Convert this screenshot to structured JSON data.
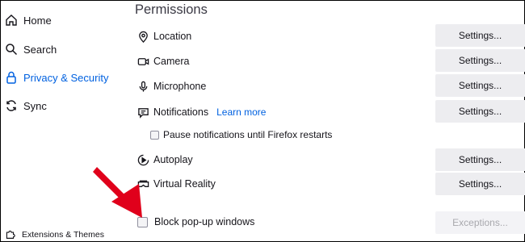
{
  "sidebar": {
    "items": [
      {
        "label": "Home",
        "icon": "home-icon"
      },
      {
        "label": "Search",
        "icon": "search-icon"
      },
      {
        "label": "Privacy & Security",
        "icon": "lock-icon",
        "selected": true
      },
      {
        "label": "Sync",
        "icon": "sync-icon"
      }
    ],
    "extensions_label": "Extensions & Themes"
  },
  "permissions": {
    "title": "Permissions",
    "rows": [
      {
        "label": "Location",
        "icon": "location-pin-icon",
        "button": "Settings..."
      },
      {
        "label": "Camera",
        "icon": "camera-icon",
        "button": "Settings..."
      },
      {
        "label": "Microphone",
        "icon": "microphone-icon",
        "button": "Settings..."
      },
      {
        "label": "Notifications",
        "icon": "notification-bubble-icon",
        "button": "Settings...",
        "link": "Learn more"
      },
      {
        "label": "Autoplay",
        "icon": "autoplay-icon",
        "button": "Settings..."
      },
      {
        "label": "Virtual Reality",
        "icon": "vr-headset-icon",
        "button": "Settings..."
      }
    ],
    "pause_notifications_label": "Pause notifications until Firefox restarts",
    "block_popups_label": "Block pop-up windows",
    "exceptions_label": "Exceptions..."
  },
  "colors": {
    "accent": "#0061e0",
    "annotation_arrow": "#e0001b",
    "button_bg": "#ededf0"
  }
}
